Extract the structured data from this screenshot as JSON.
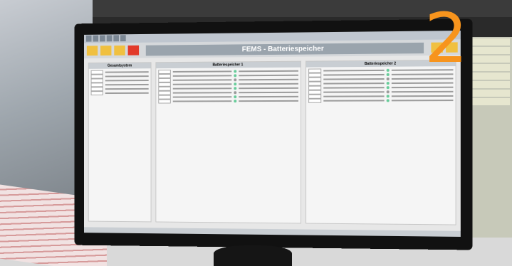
{
  "overlay_number": "2",
  "screen": {
    "title": "FEMS - Batteriespeicher",
    "panels": [
      {
        "title": "Gesamtsystem"
      },
      {
        "title": "Batteriespeicher 1"
      },
      {
        "title": "Batteriespeicher 2"
      }
    ]
  }
}
